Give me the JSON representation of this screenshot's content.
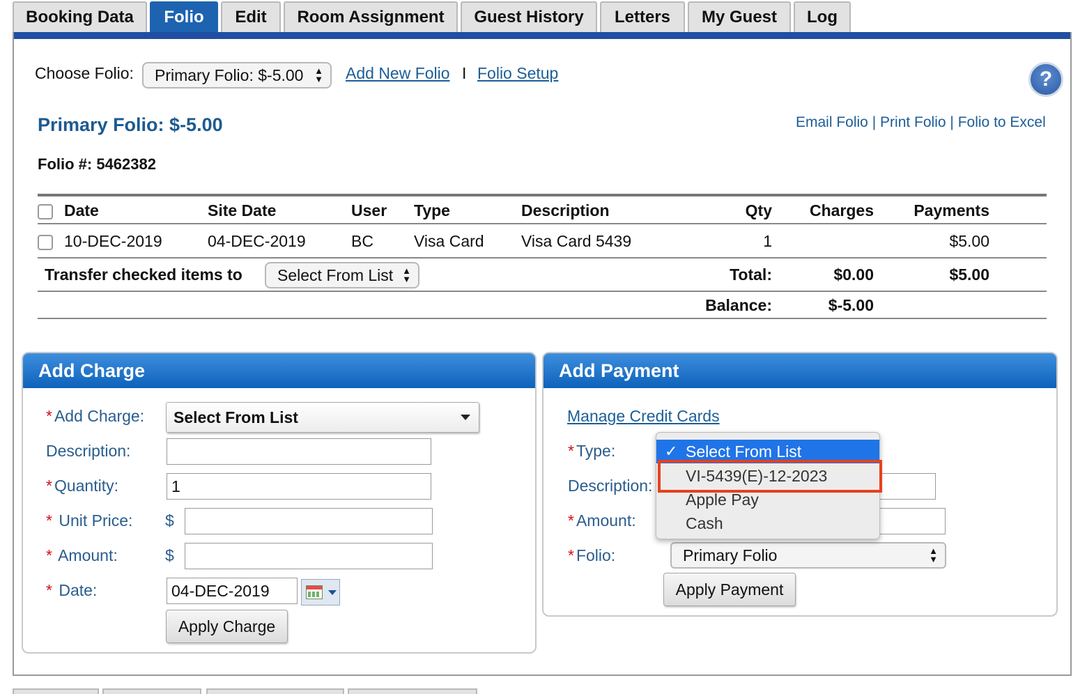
{
  "tabs": [
    {
      "label": "Booking Data",
      "active": false
    },
    {
      "label": "Folio",
      "active": true
    },
    {
      "label": "Edit",
      "active": false
    },
    {
      "label": "Room Assignment",
      "active": false
    },
    {
      "label": "Guest History",
      "active": false
    },
    {
      "label": "Letters",
      "active": false
    },
    {
      "label": "My Guest",
      "active": false
    },
    {
      "label": "Log",
      "active": false
    }
  ],
  "folio_selector": {
    "label": "Choose Folio:",
    "selected": "Primary Folio: $-5.00",
    "add_new_link": "Add New Folio",
    "separator": "I",
    "setup_link": "Folio Setup"
  },
  "help_icon": "help-icon",
  "folio": {
    "title": "Primary Folio: $-5.00",
    "number": "Folio #: 5462382",
    "actions": {
      "email": "Email Folio",
      "print": "Print Folio",
      "excel": "Folio to Excel",
      "separator": "|"
    }
  },
  "table": {
    "headers": {
      "date": "Date",
      "site_date": "Site Date",
      "user": "User",
      "type": "Type",
      "description": "Description",
      "qty": "Qty",
      "charges": "Charges",
      "payments": "Payments"
    },
    "rows": [
      {
        "date": "10-DEC-2019",
        "site_date": "04-DEC-2019",
        "user": "BC",
        "type": "Visa Card",
        "description": "Visa Card 5439",
        "qty": "1",
        "charges": "",
        "payments": "$5.00"
      }
    ],
    "transfer_label": "Transfer checked items to",
    "transfer_select": "Select From List",
    "total_label": "Total:",
    "total_charges": "$0.00",
    "total_payments": "$5.00",
    "balance_label": "Balance:",
    "balance_value": "$-5.00"
  },
  "add_charge": {
    "title": "Add Charge",
    "required_mark": "*",
    "charge_label": "Add Charge:",
    "charge_select": "Select From List",
    "description_label": "Description:",
    "description_value": "",
    "quantity_label": "Quantity:",
    "quantity_value": "1",
    "unit_price_label": "Unit Price:",
    "unit_price_value": "",
    "amount_label": "Amount:",
    "amount_value": "",
    "currency_symbol": "$",
    "date_label": "Date:",
    "date_value": "04-DEC-2019",
    "calendar_icon": "calendar-icon",
    "apply_button": "Apply Charge"
  },
  "add_payment": {
    "title": "Add Payment",
    "manage_cards_link": "Manage Credit Cards",
    "required_mark": "*",
    "type_label": "Type:",
    "description_label": "Description:",
    "amount_label": "Amount:",
    "folio_label": "Folio:",
    "folio_select": "Primary Folio",
    "apply_button": "Apply Payment",
    "type_dropdown": {
      "options": [
        "Select From List",
        "VI-5439(E)-12-2023",
        "Apple Pay",
        "Cash"
      ],
      "selected": "Select From List",
      "highlighted": "VI-5439(E)-12-2023",
      "check": "✓"
    }
  },
  "colors": {
    "accent": "#1d63b0",
    "title_blue": "#1d5a8f",
    "link": "#1c5e98",
    "required": "#d0101a",
    "highlight": "#e8401c"
  }
}
